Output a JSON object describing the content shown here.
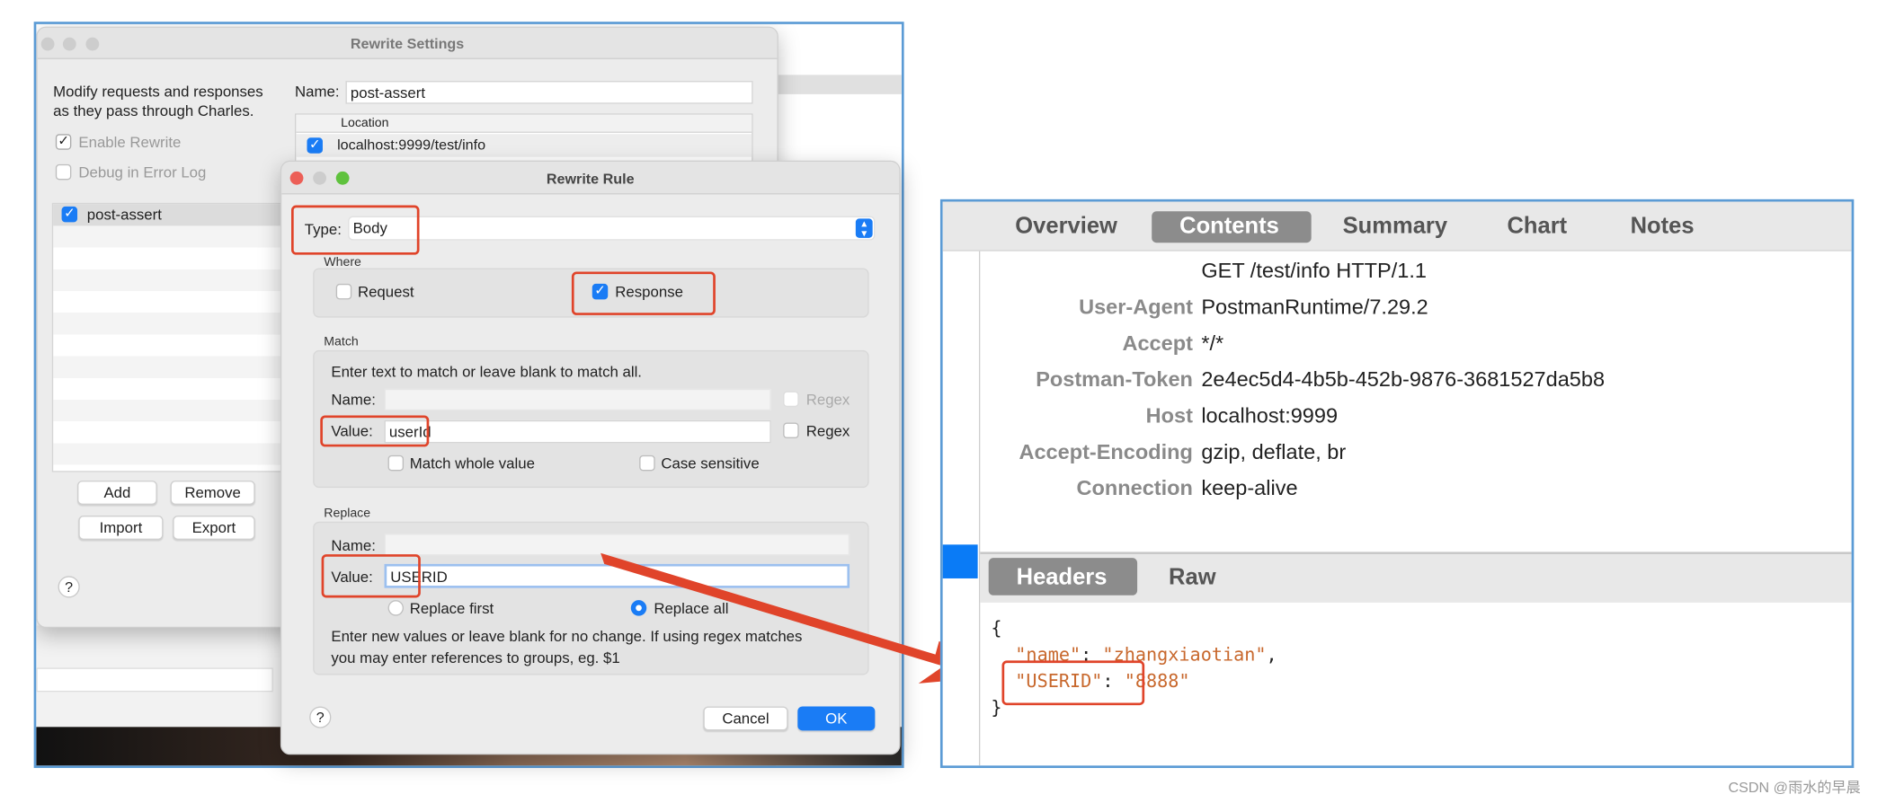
{
  "settings": {
    "title": "Rewrite Settings",
    "description_line1": "Modify requests and responses",
    "description_line2": "as they pass through Charles.",
    "enable_rewrite": {
      "label": "Enable Rewrite",
      "checked": true
    },
    "debug_log": {
      "label": "Debug in Error Log",
      "checked": false
    },
    "name_label": "Name:",
    "name_value": "post-assert",
    "location_header": "Location",
    "locations": [
      {
        "value": "localhost:9999/test/info",
        "checked": true
      }
    ],
    "sets": [
      {
        "label": "post-assert",
        "checked": true
      }
    ],
    "buttons": {
      "add": "Add",
      "remove": "Remove",
      "import": "Import",
      "export": "Export"
    },
    "help": "?"
  },
  "rule": {
    "title": "Rewrite Rule",
    "type_label": "Type:",
    "type_value": "Body",
    "where_label": "Where",
    "request": {
      "label": "Request",
      "checked": false
    },
    "response": {
      "label": "Response",
      "checked": true
    },
    "match_label": "Match",
    "match_hint": "Enter text to match or leave blank to match all.",
    "match_name_label": "Name:",
    "match_name_value": "",
    "match_value_label": "Value:",
    "match_value": "userId",
    "regex_label": "Regex",
    "match_whole": "Match whole value",
    "case_sensitive": "Case sensitive",
    "replace_label": "Replace",
    "replace_name_label": "Name:",
    "replace_value_label": "Value:",
    "replace_value": "USERID",
    "replace_first": "Replace first",
    "replace_all": "Replace all",
    "replace_mode": "Replace all",
    "hint_line1": "Enter new values or leave blank for no change. If using regex matches",
    "hint_line2": "you may enter references to groups, eg. $1",
    "help": "?",
    "cancel": "Cancel",
    "ok": "OK"
  },
  "inspector": {
    "tabs": [
      "Overview",
      "Contents",
      "Summary",
      "Chart",
      "Notes"
    ],
    "active_tab": "Contents",
    "request_line": "GET /test/info HTTP/1.1",
    "headers": [
      {
        "key": "User-Agent",
        "value": "PostmanRuntime/7.29.2"
      },
      {
        "key": "Accept",
        "value": "*/*"
      },
      {
        "key": "Postman-Token",
        "value": "2e4ec5d4-4b5b-452b-9876-3681527da5b8"
      },
      {
        "key": "Host",
        "value": "localhost:9999"
      },
      {
        "key": "Accept-Encoding",
        "value": "gzip, deflate, br"
      },
      {
        "key": "Connection",
        "value": "keep-alive"
      }
    ],
    "sub_tabs": [
      "Headers",
      "Raw"
    ],
    "active_sub_tab": "Headers",
    "body": {
      "open": "{",
      "close": "}",
      "name_key": "\"name\"",
      "name_value": "\"zhangxiaotian\"",
      "userid_key": "\"USERID\"",
      "userid_value": "\"8888\""
    }
  },
  "watermark": "CSDN @雨水的早晨",
  "colors": {
    "highlight": "#e0442a",
    "accent": "#1a7cf5",
    "frame": "#5b9bd5",
    "json_string": "#c8682d"
  }
}
